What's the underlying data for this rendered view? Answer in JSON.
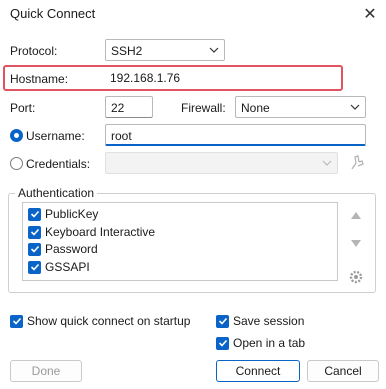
{
  "window": {
    "title": "Quick Connect"
  },
  "labels": {
    "protocol": "Protocol:",
    "hostname": "Hostname:",
    "port": "Port:",
    "firewall": "Firewall:",
    "username": "Username:",
    "credentials": "Credentials:",
    "authentication": "Authentication"
  },
  "fields": {
    "protocol": "SSH2",
    "hostname": "192.168.1.76",
    "port": "22",
    "firewall": "None",
    "username": "root",
    "credentials": ""
  },
  "auth_methods": [
    {
      "label": "PublicKey",
      "checked": true
    },
    {
      "label": "Keyboard Interactive",
      "checked": true
    },
    {
      "label": "Password",
      "checked": true
    },
    {
      "label": "GSSAPI",
      "checked": true
    }
  ],
  "options": {
    "show_quick_connect": "Show quick connect on startup",
    "save_session": "Save session",
    "open_in_tab": "Open in a tab"
  },
  "buttons": {
    "done": "Done",
    "connect": "Connect",
    "cancel": "Cancel"
  },
  "colors": {
    "accent": "#0a64c8",
    "highlight": "#e0535f"
  }
}
